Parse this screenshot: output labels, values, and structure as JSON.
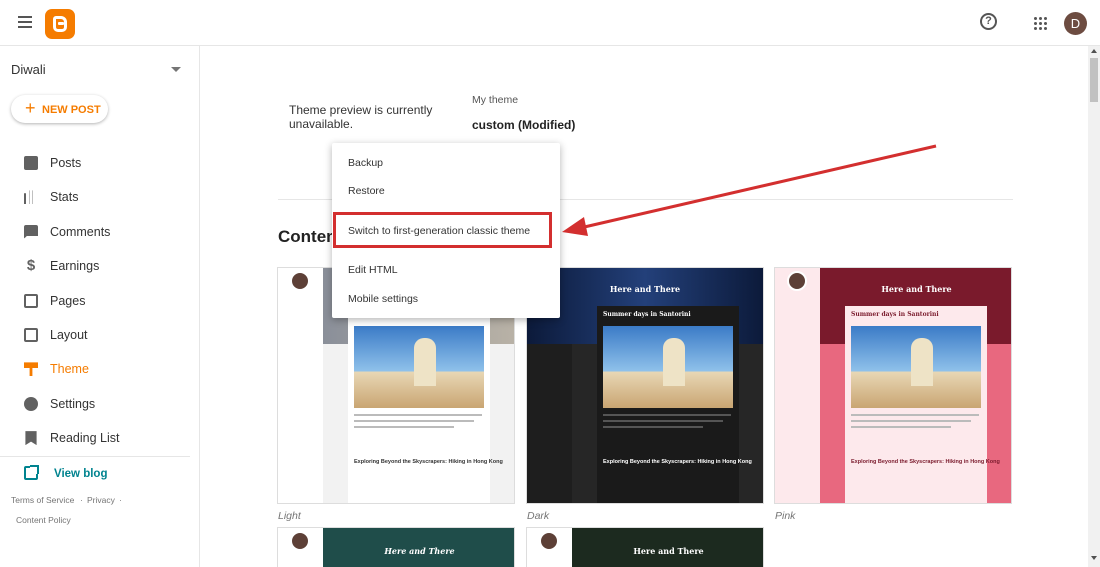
{
  "app": {
    "logo": "blogger-logo",
    "avatar_initial": "D"
  },
  "sidebar": {
    "blog_name": "Diwali",
    "new_post_label": "NEW POST",
    "items": [
      {
        "label": "Posts",
        "icon": "posts-icon"
      },
      {
        "label": "Stats",
        "icon": "stats-icon"
      },
      {
        "label": "Comments",
        "icon": "comments-icon"
      },
      {
        "label": "Earnings",
        "icon": "earnings-icon"
      },
      {
        "label": "Pages",
        "icon": "pages-icon"
      },
      {
        "label": "Layout",
        "icon": "layout-icon"
      },
      {
        "label": "Theme",
        "icon": "theme-icon",
        "active": true
      },
      {
        "label": "Settings",
        "icon": "settings-icon"
      },
      {
        "label": "Reading List",
        "icon": "reading-list-icon"
      }
    ],
    "view_blog": "View blog",
    "footer": {
      "terms": "Terms of Service",
      "privacy": "Privacy",
      "content_policy": "Content Policy"
    }
  },
  "main": {
    "preview_message": "Theme preview is currently unavailable.",
    "my_theme_label": "My theme",
    "my_theme_value": "custom (Modified)",
    "section_title": "Contemporary",
    "themes": [
      {
        "name": "Light"
      },
      {
        "name": "Dark"
      },
      {
        "name": "Pink"
      }
    ],
    "theme_preview": {
      "banner_title": "Here and There",
      "post_title": "Summer days in Santorini",
      "post2_title": "Exploring Beyond the Skyscrapers: Hiking in Hong Kong"
    }
  },
  "dropdown": {
    "items": [
      "Backup",
      "Restore",
      "Switch to first-generation classic theme",
      "Edit HTML",
      "Mobile settings"
    ]
  },
  "colors": {
    "accent": "#f57c00",
    "highlight": "#d32f2f",
    "link": "#00838f"
  }
}
